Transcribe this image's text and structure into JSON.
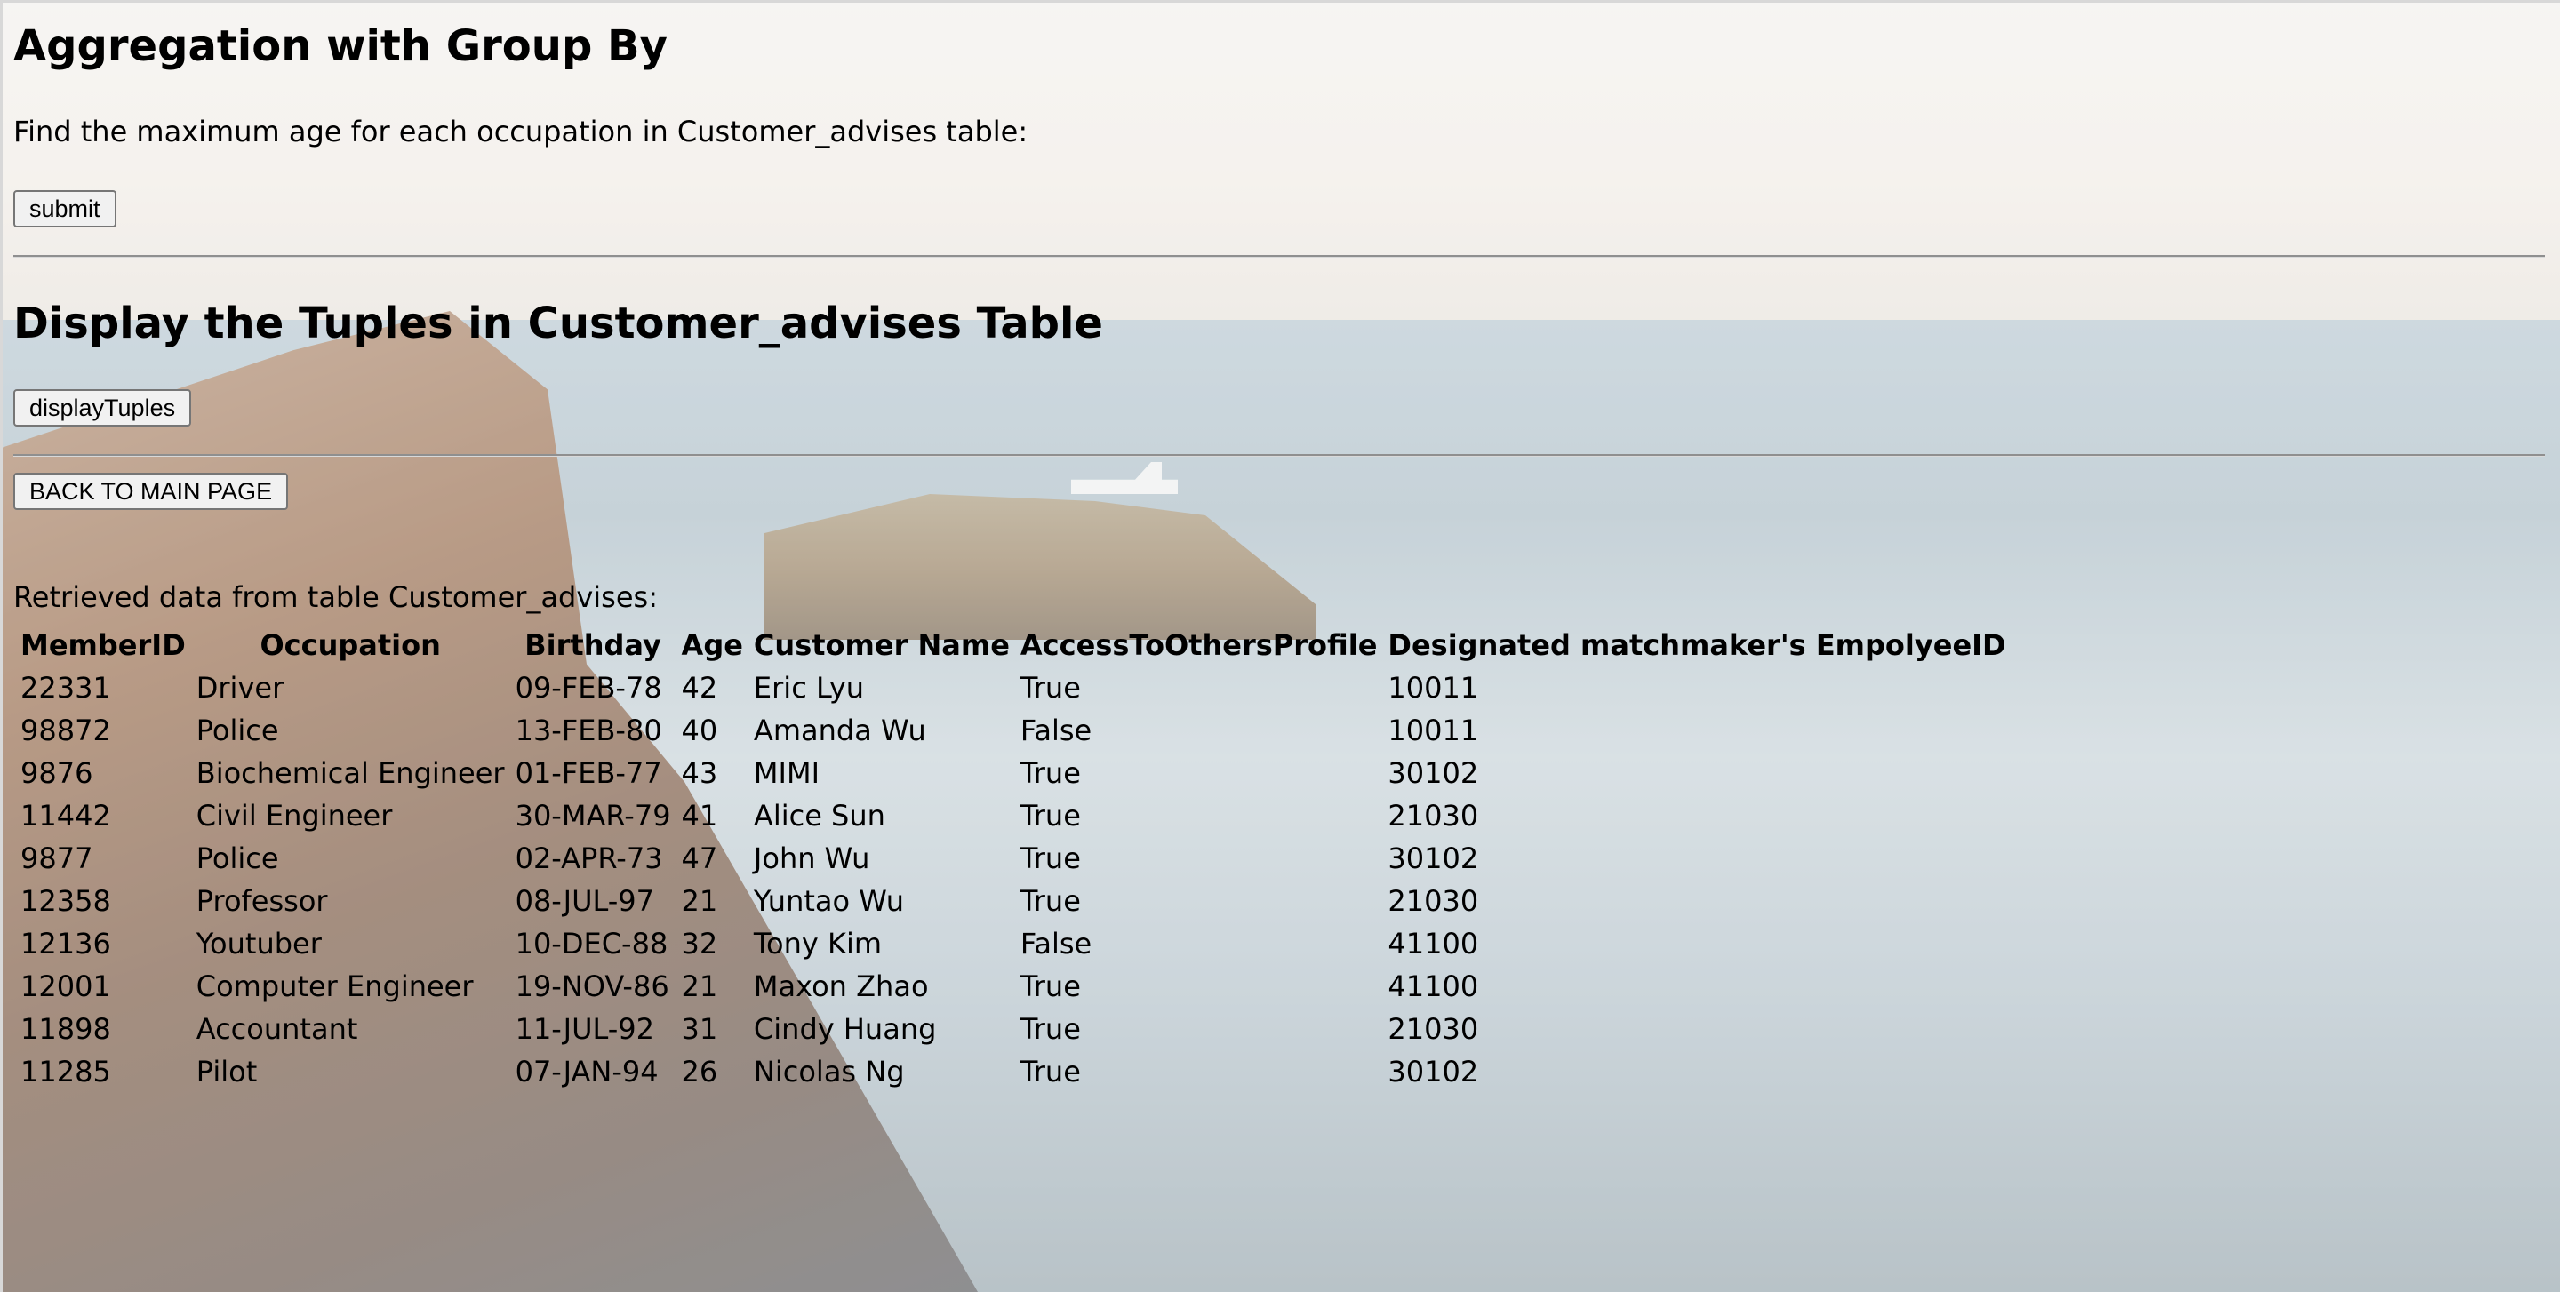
{
  "section1": {
    "title": "Aggregation with Group By",
    "description": "Find the maximum age for each occupation in Customer_advises table:",
    "submit_label": "submit"
  },
  "section2": {
    "title": "Display the Tuples in Customer_advises Table",
    "display_label": "displayTuples"
  },
  "back_button_label": "BACK TO MAIN PAGE",
  "retrieved": {
    "caption": "Retrieved data from table Customer_advises:",
    "columns": [
      "MemberID",
      "Occupation",
      "Birthday",
      "Age",
      "Customer Name",
      "AccessToOthersProfile",
      "Designated matchmaker's EmpolyeeID"
    ],
    "rows": [
      [
        "22331",
        "Driver",
        "09-FEB-78",
        "42",
        "Eric Lyu",
        "True",
        "10011"
      ],
      [
        "98872",
        "Police",
        "13-FEB-80",
        "40",
        "Amanda Wu",
        "False",
        "10011"
      ],
      [
        "9876",
        "Biochemical Engineer",
        "01-FEB-77",
        "43",
        "MIMI",
        "True",
        "30102"
      ],
      [
        "11442",
        "Civil Engineer",
        "30-MAR-79",
        "41",
        "Alice Sun",
        "True",
        "21030"
      ],
      [
        "9877",
        "Police",
        "02-APR-73",
        "47",
        "John Wu",
        "True",
        "30102"
      ],
      [
        "12358",
        "Professor",
        "08-JUL-97",
        "21",
        "Yuntao Wu",
        "True",
        "21030"
      ],
      [
        "12136",
        "Youtuber",
        "10-DEC-88",
        "32",
        "Tony Kim",
        "False",
        "41100"
      ],
      [
        "12001",
        "Computer Engineer",
        "19-NOV-86",
        "21",
        "Maxon Zhao",
        "True",
        "41100"
      ],
      [
        "11898",
        "Accountant",
        "11-JUL-92",
        "31",
        "Cindy Huang",
        "True",
        "21030"
      ],
      [
        "11285",
        "Pilot",
        "07-JAN-94",
        "26",
        "Nicolas Ng",
        "True",
        "30102"
      ]
    ]
  }
}
